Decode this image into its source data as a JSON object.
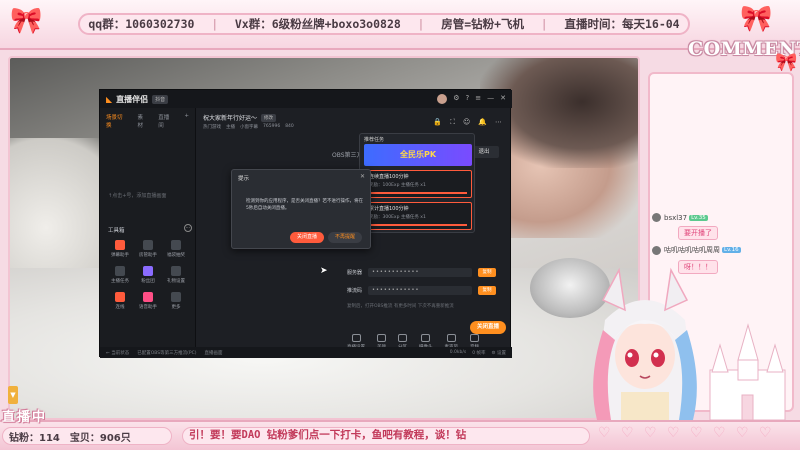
{
  "overlay": {
    "info_items": [
      "qq群：1060302730",
      "Vx群：6级粉丝牌+boxo3o0828",
      "房管=钻粉+飞机",
      "直播时间：每天16-04"
    ],
    "comments_title": "COMMENTS",
    "live_label": "直播中",
    "stats": {
      "diamond": "钻粉：114",
      "treasure": "宝贝：906只"
    },
    "marquee": "引！要！要DAO    钻粉爹们点一下打卡，鱼吧有教程，谈！钻",
    "colors": {
      "frame_pink": "#f2c4d2",
      "accent": "#c23a5a"
    }
  },
  "chat": [
    {
      "user": "bsxl37",
      "level": "Lv.35",
      "message": "要开播了"
    },
    {
      "user": "咕叽咕叽咕叽周周",
      "level": "Lv.16",
      "message": "呀！！！"
    }
  ],
  "app": {
    "name": "直播伴侣",
    "version": "抖音",
    "left_tabs": [
      "场景切换",
      "素材",
      "直播间"
    ],
    "empty_tip": "↑点击+号，添加直播画面",
    "tools_label": "工具箱",
    "tools": [
      {
        "label": "弹幕助手",
        "icon": "danmu-icon",
        "tone": "hot"
      },
      {
        "label": "房管助手",
        "icon": "admin-icon",
        "tone": "normal"
      },
      {
        "label": "福袋抽奖",
        "icon": "gift-icon",
        "tone": "normal"
      },
      {
        "label": "主播任务",
        "icon": "task-icon",
        "tone": "normal"
      },
      {
        "label": "粉丝团",
        "icon": "fans-icon",
        "tone": "purple"
      },
      {
        "label": "礼物设置",
        "icon": "present-icon",
        "tone": "normal"
      },
      {
        "label": "连线",
        "icon": "link-icon",
        "tone": "hot"
      },
      {
        "label": "语音助手",
        "icon": "voice-icon",
        "tone": "pink"
      },
      {
        "label": "更多",
        "icon": "more-icon",
        "tone": "normal"
      }
    ],
    "left_bottom": "↻ 当前状态",
    "title": "祝大家新年行好运～",
    "title_chip": "修改",
    "sub_info": [
      "热门游戏",
      "主播",
      "小窗字幕",
      "765996",
      "840"
    ],
    "obs_line": "OBS第三方",
    "obs_button": "退出",
    "fields": [
      {
        "label": "服务器",
        "value": "••••••••••••",
        "button": "复制"
      },
      {
        "label": "推流码",
        "value": "••••••••••••",
        "button": "复制"
      }
    ],
    "hint": "复制后，打开OBS推流 有更多时间 下次不再重新推流",
    "toolbar": [
      "直播设置",
      "美颜",
      "分区",
      "摄像头",
      "麦克风",
      "音频"
    ],
    "start_button": "关闭直播",
    "status_left": [
      "← 当前状态",
      "已配置OBS等第三方推流(PC)",
      "直播画面"
    ],
    "status_right": [
      "0.0kb/s",
      "0 帧率",
      "⚙ 设置"
    ],
    "pk": {
      "header": "推荐任务",
      "banner": "全民乐PK",
      "items": [
        {
          "title": "连续直播100分钟",
          "sub": "奖励：100Exp  主播任务 x1"
        },
        {
          "title": "累计直播100分钟",
          "sub": "奖励：300Exp  主播任务 x1"
        }
      ]
    },
    "dialog": {
      "title": "提示",
      "message": "检测到你的应用程序，是否关闭直播？若不进行操作，将在5秒后自动关闭直播。",
      "primary": "关闭直播",
      "secondary": "不再提醒"
    }
  }
}
